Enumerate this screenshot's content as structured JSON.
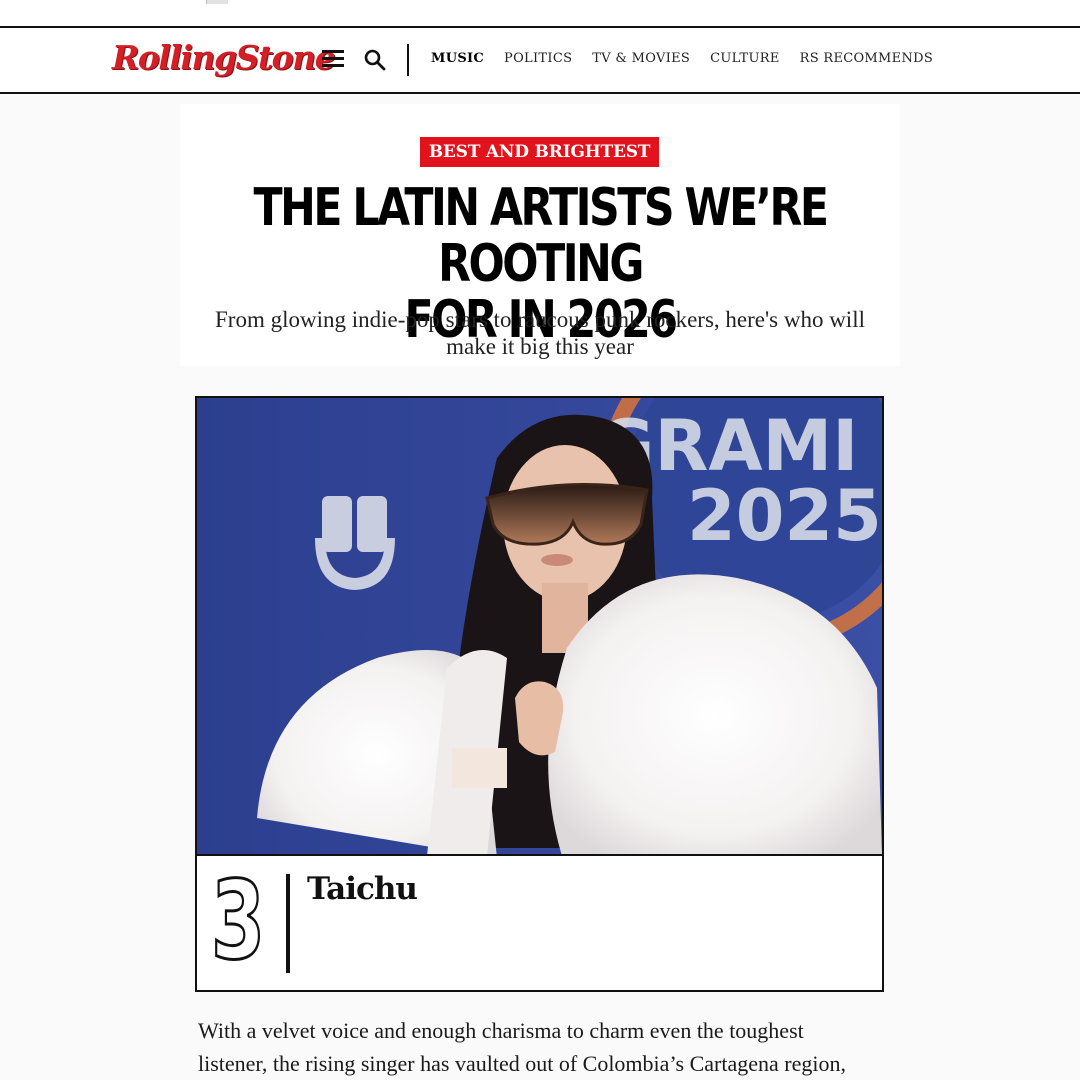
{
  "site": {
    "logo": "RollingStone"
  },
  "nav": {
    "items": [
      {
        "label": "MUSIC"
      },
      {
        "label": "POLITICS"
      },
      {
        "label": "TV & MOVIES"
      },
      {
        "label": "CULTURE"
      },
      {
        "label": "RS RECOMMENDS"
      }
    ],
    "active": "MUSIC",
    "icons": [
      "menu-icon",
      "search-icon"
    ]
  },
  "article": {
    "kicker": "BEST AND BRIGHTEST",
    "headline_line1": "THE LATIN ARTISTS WE’RE ROOTING",
    "headline_line2": "FOR IN 2026",
    "dek": "From glowing indie-pop stars to raucous punk rockers, here's who will make it big this year",
    "entry": {
      "rank": "3",
      "artist": "Taichu",
      "photo_backdrop_text_1": "GRAMI",
      "photo_backdrop_text_2": "2025"
    },
    "body_line1": "With a velvet voice and enough charisma to charm even the toughest",
    "body_line2": "listener, the rising singer has vaulted out of Colombia’s Cartagena region,"
  },
  "colors": {
    "brand_red": "#d32027",
    "kicker_red": "#e2131c",
    "text": "#111111"
  }
}
